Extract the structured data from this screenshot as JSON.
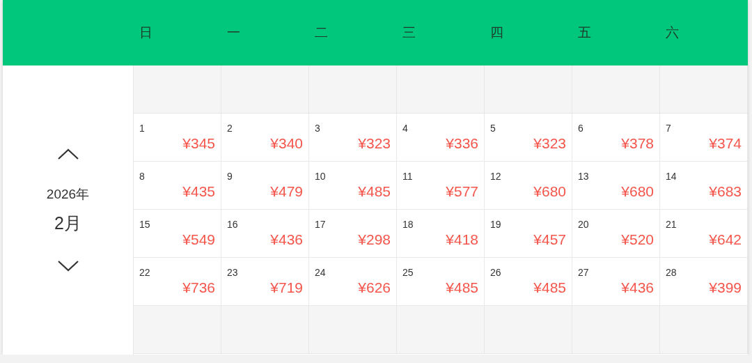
{
  "weekdays": [
    "日",
    "一",
    "二",
    "三",
    "四",
    "五",
    "六"
  ],
  "nav": {
    "year": "2026年",
    "month": "2月"
  },
  "weeks": [
    {
      "kind": "blank"
    },
    {
      "kind": "days",
      "days": [
        {
          "date": "1",
          "price": "¥345"
        },
        {
          "date": "2",
          "price": "¥340"
        },
        {
          "date": "3",
          "price": "¥323"
        },
        {
          "date": "4",
          "price": "¥336"
        },
        {
          "date": "5",
          "price": "¥323"
        },
        {
          "date": "6",
          "price": "¥378"
        },
        {
          "date": "7",
          "price": "¥374"
        }
      ]
    },
    {
      "kind": "days",
      "days": [
        {
          "date": "8",
          "price": "¥435"
        },
        {
          "date": "9",
          "price": "¥479"
        },
        {
          "date": "10",
          "price": "¥485"
        },
        {
          "date": "11",
          "price": "¥577"
        },
        {
          "date": "12",
          "price": "¥680"
        },
        {
          "date": "13",
          "price": "¥680"
        },
        {
          "date": "14",
          "price": "¥683"
        }
      ]
    },
    {
      "kind": "days",
      "days": [
        {
          "date": "15",
          "price": "¥549"
        },
        {
          "date": "16",
          "price": "¥436"
        },
        {
          "date": "17",
          "price": "¥298"
        },
        {
          "date": "18",
          "price": "¥418"
        },
        {
          "date": "19",
          "price": "¥457"
        },
        {
          "date": "20",
          "price": "¥520"
        },
        {
          "date": "21",
          "price": "¥642"
        }
      ]
    },
    {
      "kind": "days",
      "days": [
        {
          "date": "22",
          "price": "¥736"
        },
        {
          "date": "23",
          "price": "¥719"
        },
        {
          "date": "24",
          "price": "¥626"
        },
        {
          "date": "25",
          "price": "¥485"
        },
        {
          "date": "26",
          "price": "¥485"
        },
        {
          "date": "27",
          "price": "¥436"
        },
        {
          "date": "28",
          "price": "¥399"
        }
      ]
    },
    {
      "kind": "blank"
    }
  ]
}
